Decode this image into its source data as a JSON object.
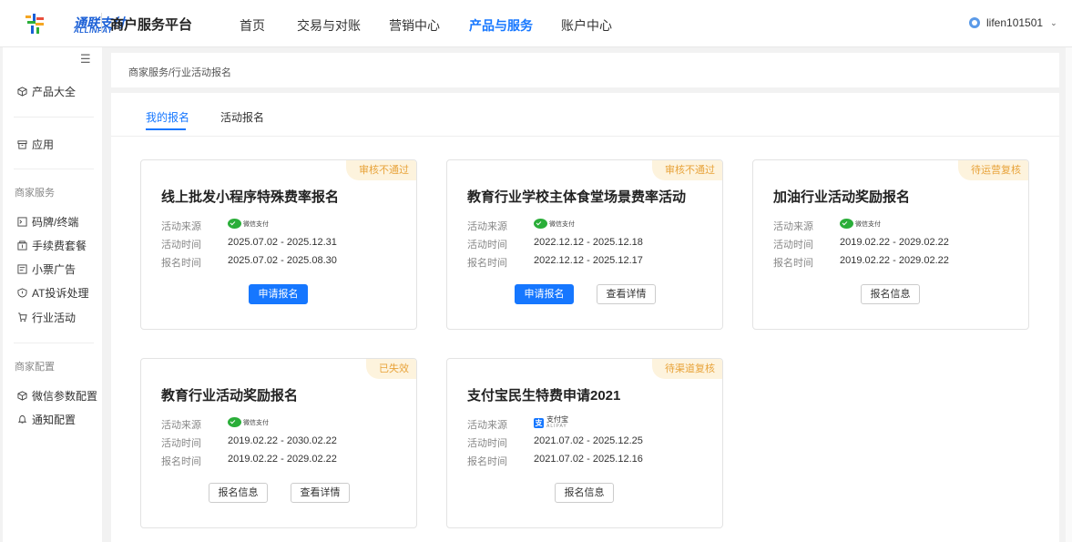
{
  "header": {
    "logo_text": "通联支付",
    "logo_sub": "ALLINPAY",
    "platform": "商户服务平台",
    "nav": [
      "首页",
      "交易与对账",
      "营销中心",
      "产品与服务",
      "账户中心"
    ],
    "active_nav": "产品与服务",
    "username": "lifen101501"
  },
  "sidebar": {
    "items_top": [
      {
        "label": "产品大全",
        "icon": "cube-icon"
      },
      {
        "label": "应用",
        "icon": "box-icon"
      }
    ],
    "group1_title": "商家服务",
    "group1_items": [
      {
        "label": "码牌/终端",
        "icon": "terminal-icon"
      },
      {
        "label": "手续费套餐",
        "icon": "package-icon"
      },
      {
        "label": "小票广告",
        "icon": "receipt-icon"
      },
      {
        "label": "AT投诉处理",
        "icon": "shield-icon"
      },
      {
        "label": "行业活动",
        "icon": "cart-icon"
      }
    ],
    "group2_title": "商家配置",
    "group2_items": [
      {
        "label": "微信参数配置",
        "icon": "cube-icon"
      },
      {
        "label": "通知配置",
        "icon": "bell-icon"
      }
    ]
  },
  "breadcrumb": "商家服务/行业活动报名",
  "tabs": [
    "我的报名",
    "活动报名"
  ],
  "active_tab": "我的报名",
  "labels": {
    "source": "活动来源",
    "activity_time": "活动时间",
    "signup_time": "报名时间"
  },
  "cards": [
    {
      "badge": "审核不通过",
      "title": "线上批发小程序特殊费率报名",
      "source": "微信支付",
      "activity_time": "2025.07.02 - 2025.12.31",
      "signup_time": "2025.07.02 - 2025.08.30",
      "buttons": [
        "申请报名"
      ]
    },
    {
      "badge": "审核不通过",
      "title": "教育行业学校主体食堂场景费率活动",
      "source": "微信支付",
      "activity_time": "2022.12.12 - 2025.12.18",
      "signup_time": "2022.12.12 - 2025.12.17",
      "buttons": [
        "申请报名",
        "查看详情"
      ]
    },
    {
      "badge": "待运营复核",
      "title": "加油行业活动奖励报名",
      "source": "微信支付",
      "activity_time": "2019.02.22 - 2029.02.22",
      "signup_time": "2019.02.22 - 2029.02.22",
      "buttons": [
        "报名信息"
      ]
    },
    {
      "badge": "已失效",
      "title": "教育行业活动奖励报名",
      "source": "微信支付",
      "activity_time": "2019.02.22 - 2030.02.22",
      "signup_time": "2019.02.22 - 2029.02.22",
      "buttons": [
        "报名信息",
        "查看详情"
      ]
    },
    {
      "badge": "待渠道复核",
      "title": "支付宝民生特费申请2021",
      "source": "支付宝",
      "source_sub": "ALIPAY",
      "activity_time": "2021.07.02 - 2025.12.25",
      "signup_time": "2021.07.02 - 2025.12.16",
      "buttons": [
        "报名信息"
      ]
    }
  ],
  "colors": {
    "accent": "#1677ff",
    "badge_text": "#e8a33a",
    "badge_bg": "#fdf3dd",
    "wechat": "#2aae39"
  }
}
